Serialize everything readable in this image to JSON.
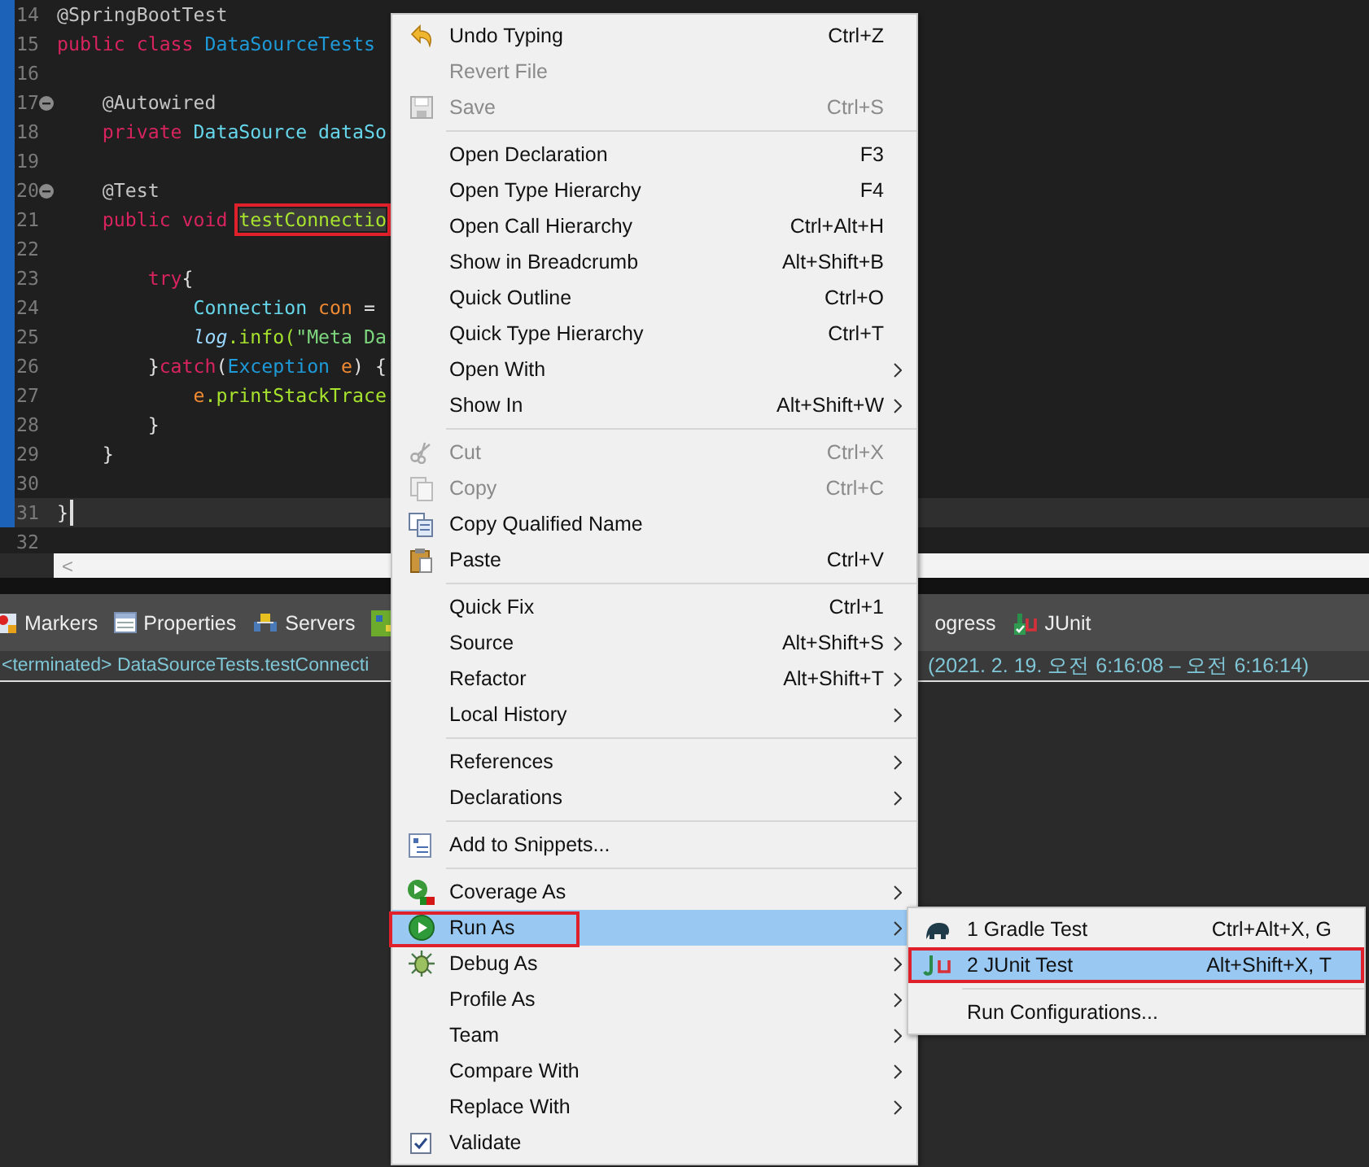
{
  "editor": {
    "lines": [
      {
        "number": "14",
        "changed": true,
        "fold": false,
        "current": false,
        "tokens": [
          {
            "kind": "annotation",
            "text": "@SpringBootTest"
          }
        ]
      },
      {
        "number": "15",
        "changed": true,
        "fold": false,
        "current": false,
        "tokens": [
          {
            "kind": "keyword",
            "text": "public class "
          },
          {
            "kind": "class",
            "text": "DataSourceTests"
          }
        ]
      },
      {
        "number": "16",
        "changed": true,
        "fold": false,
        "current": false
      },
      {
        "number": "17",
        "changed": true,
        "fold": true,
        "current": false,
        "tokens": [
          {
            "kind": "annotation",
            "text": "    @Autowired"
          }
        ]
      },
      {
        "number": "18",
        "changed": true,
        "fold": false,
        "current": false,
        "tokens": [
          {
            "kind": "keyword",
            "text": "    private "
          },
          {
            "kind": "type",
            "text": "DataSource "
          },
          {
            "kind": "field",
            "text": "dataSo"
          }
        ]
      },
      {
        "number": "19",
        "changed": true,
        "fold": false,
        "current": false
      },
      {
        "number": "20",
        "changed": true,
        "fold": true,
        "current": false,
        "tokens": [
          {
            "kind": "annotation",
            "text": "    @Test"
          }
        ]
      },
      {
        "number": "21",
        "changed": true,
        "fold": false,
        "current": false,
        "tokens": [
          {
            "kind": "keyword",
            "text": "    public void "
          },
          {
            "kind": "method",
            "text": "testConnectio",
            "annotated": true
          }
        ]
      },
      {
        "number": "22",
        "changed": true,
        "fold": false,
        "current": false
      },
      {
        "number": "23",
        "changed": true,
        "fold": false,
        "current": false,
        "tokens": [
          {
            "kind": "keyword",
            "text": "        try"
          },
          {
            "kind": "plain",
            "text": "{"
          }
        ]
      },
      {
        "number": "24",
        "changed": true,
        "fold": false,
        "current": false,
        "tokens": [
          {
            "kind": "type",
            "text": "            Connection "
          },
          {
            "kind": "variable",
            "text": "con"
          },
          {
            "kind": "plain",
            "text": " ="
          }
        ]
      },
      {
        "number": "25",
        "changed": true,
        "fold": false,
        "current": false,
        "tokens": [
          {
            "kind": "static",
            "text": "            log"
          },
          {
            "kind": "method",
            "text": ".info("
          },
          {
            "kind": "string",
            "text": "\"Meta Da"
          }
        ]
      },
      {
        "number": "26",
        "changed": true,
        "fold": false,
        "current": false,
        "tokens": [
          {
            "kind": "plain",
            "text": "        }"
          },
          {
            "kind": "keyword",
            "text": "catch"
          },
          {
            "kind": "plain",
            "text": "("
          },
          {
            "kind": "class",
            "text": "Exception "
          },
          {
            "kind": "variable",
            "text": "e"
          },
          {
            "kind": "plain",
            "text": ") {"
          }
        ]
      },
      {
        "number": "27",
        "changed": true,
        "fold": false,
        "current": false,
        "tokens": [
          {
            "kind": "variable",
            "text": "            e"
          },
          {
            "kind": "method",
            "text": ".printStackTrace"
          }
        ]
      },
      {
        "number": "28",
        "changed": true,
        "fold": false,
        "current": false,
        "tokens": [
          {
            "kind": "plain",
            "text": "        }"
          }
        ]
      },
      {
        "number": "29",
        "changed": true,
        "fold": false,
        "current": false,
        "tokens": [
          {
            "kind": "plain",
            "text": "    }"
          }
        ]
      },
      {
        "number": "30",
        "changed": true,
        "fold": false,
        "current": false
      },
      {
        "number": "31",
        "changed": true,
        "fold": false,
        "current": true,
        "tokens": [
          {
            "kind": "plain",
            "text": "}"
          }
        ]
      },
      {
        "number": "32",
        "changed": false,
        "fold": false,
        "current": false
      }
    ],
    "scroll_arrow": "<"
  },
  "bottom_tabs": [
    {
      "label": "Markers",
      "kind": "markers"
    },
    {
      "label": "Properties",
      "kind": "properties"
    },
    {
      "label": "Servers",
      "kind": "servers"
    },
    {
      "kind": "grid"
    },
    {
      "label": "ogress",
      "kind": "plain"
    },
    {
      "label": "JUnit",
      "kind": "junit"
    }
  ],
  "status": {
    "left": "<terminated> DataSourceTests.testConnecti",
    "right": "(2021. 2. 19. 오전 6:16:08 – 오전 6:16:14)"
  },
  "context_menu": {
    "items": [
      {
        "kind": "undo",
        "label": "Undo Typing",
        "shortcut": "Ctrl+Z",
        "disabled": false,
        "submenu": false,
        "selected": false
      },
      {
        "kind": "plain",
        "label": "Revert File",
        "disabled": true,
        "submenu": false,
        "selected": false
      },
      {
        "kind": "save",
        "label": "Save",
        "shortcut": "Ctrl+S",
        "disabled": true,
        "submenu": false,
        "selected": false
      },
      {
        "kind": "separator"
      },
      {
        "kind": "plain",
        "label": "Open Declaration",
        "shortcut": "F3",
        "disabled": false,
        "submenu": false,
        "selected": false
      },
      {
        "kind": "plain",
        "label": "Open Type Hierarchy",
        "shortcut": "F4",
        "disabled": false,
        "submenu": false,
        "selected": false
      },
      {
        "kind": "plain",
        "label": "Open Call Hierarchy",
        "shortcut": "Ctrl+Alt+H",
        "disabled": false,
        "submenu": false,
        "selected": false
      },
      {
        "kind": "plain",
        "label": "Show in Breadcrumb",
        "shortcut": "Alt+Shift+B",
        "disabled": false,
        "submenu": false,
        "selected": false
      },
      {
        "kind": "plain",
        "label": "Quick Outline",
        "shortcut": "Ctrl+O",
        "disabled": false,
        "submenu": false,
        "selected": false
      },
      {
        "kind": "plain",
        "label": "Quick Type Hierarchy",
        "shortcut": "Ctrl+T",
        "disabled": false,
        "submenu": false,
        "selected": false
      },
      {
        "kind": "plain",
        "label": "Open With",
        "disabled": false,
        "submenu": true,
        "selected": false
      },
      {
        "kind": "plain",
        "label": "Show In",
        "shortcut": "Alt+Shift+W",
        "disabled": false,
        "submenu": true,
        "selected": false
      },
      {
        "kind": "separator"
      },
      {
        "kind": "cut",
        "label": "Cut",
        "shortcut": "Ctrl+X",
        "disabled": true,
        "submenu": false,
        "selected": false
      },
      {
        "kind": "copy",
        "label": "Copy",
        "shortcut": "Ctrl+C",
        "disabled": true,
        "submenu": false,
        "selected": false
      },
      {
        "kind": "copyname",
        "label": "Copy Qualified Name",
        "disabled": false,
        "submenu": false,
        "selected": false
      },
      {
        "kind": "paste",
        "label": "Paste",
        "shortcut": "Ctrl+V",
        "disabled": false,
        "submenu": false,
        "selected": false
      },
      {
        "kind": "separator"
      },
      {
        "kind": "plain",
        "label": "Quick Fix",
        "shortcut": "Ctrl+1",
        "disabled": false,
        "submenu": false,
        "selected": false
      },
      {
        "kind": "plain",
        "label": "Source",
        "shortcut": "Alt+Shift+S",
        "disabled": false,
        "submenu": true,
        "selected": false
      },
      {
        "kind": "plain",
        "label": "Refactor",
        "shortcut": "Alt+Shift+T",
        "disabled": false,
        "submenu": true,
        "selected": false
      },
      {
        "kind": "plain",
        "label": "Local History",
        "disabled": false,
        "submenu": true,
        "selected": false
      },
      {
        "kind": "separator"
      },
      {
        "kind": "plain",
        "label": "References",
        "disabled": false,
        "submenu": true,
        "selected": false
      },
      {
        "kind": "plain",
        "label": "Declarations",
        "disabled": false,
        "submenu": true,
        "selected": false
      },
      {
        "kind": "separator"
      },
      {
        "kind": "snippets",
        "label": "Add to Snippets...",
        "disabled": false,
        "submenu": false,
        "selected": false
      },
      {
        "kind": "separator"
      },
      {
        "kind": "coverage",
        "label": "Coverage As",
        "disabled": false,
        "submenu": true,
        "selected": false
      },
      {
        "kind": "run",
        "label": "Run As",
        "disabled": false,
        "submenu": true,
        "selected": true,
        "annotated": true
      },
      {
        "kind": "debug",
        "label": "Debug As",
        "disabled": false,
        "submenu": true,
        "selected": false
      },
      {
        "kind": "plain",
        "label": "Profile As",
        "disabled": false,
        "submenu": true,
        "selected": false
      },
      {
        "kind": "plain",
        "label": "Team",
        "disabled": false,
        "submenu": true,
        "selected": false
      },
      {
        "kind": "plain",
        "label": "Compare With",
        "disabled": false,
        "submenu": true,
        "selected": false
      },
      {
        "kind": "plain",
        "label": "Replace With",
        "disabled": false,
        "submenu": true,
        "selected": false
      },
      {
        "kind": "check",
        "label": "Validate",
        "disabled": false,
        "submenu": false,
        "selected": false
      }
    ]
  },
  "submenu": {
    "items": [
      {
        "kind": "elephant",
        "label": "1 Gradle Test",
        "shortcut": "Ctrl+Alt+X, G",
        "selected": false,
        "annotated": false
      },
      {
        "kind": "junit",
        "label": "2 JUnit Test",
        "shortcut": "Alt+Shift+X, T",
        "selected": true,
        "annotated": true
      },
      {
        "kind": "separator"
      },
      {
        "kind": "plain",
        "label": "Run Configurations...",
        "selected": false,
        "annotated": false
      }
    ]
  }
}
